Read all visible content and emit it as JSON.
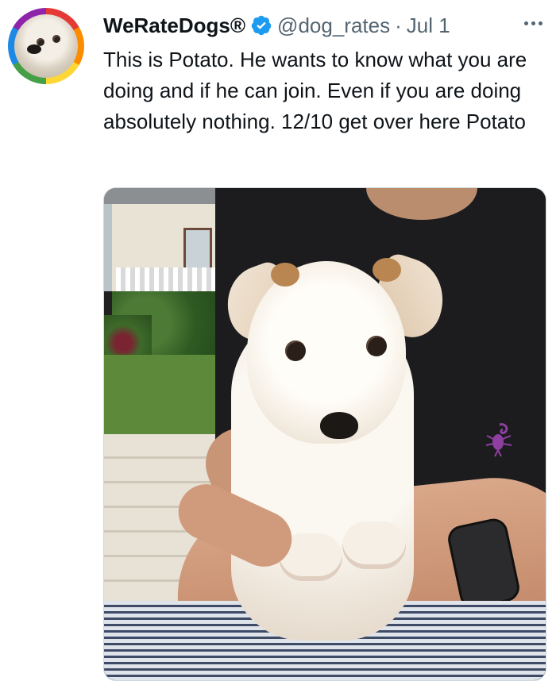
{
  "tweet": {
    "display_name": "WeRateDogs®",
    "handle": "@dog_rates",
    "separator": "·",
    "date": "Jul 1",
    "text": "This is Potato. He wants to know what you are doing and if he can join. Even if you are doing absolutely nothing. 12/10 get over here Potato"
  },
  "icons": {
    "verified": "verified-badge-icon",
    "more": "more-options-icon",
    "avatar": "avatar"
  },
  "colors": {
    "text": "#0f1419",
    "secondary": "#536471",
    "verified": "#1d9bf0",
    "border": "#cfd9de"
  }
}
